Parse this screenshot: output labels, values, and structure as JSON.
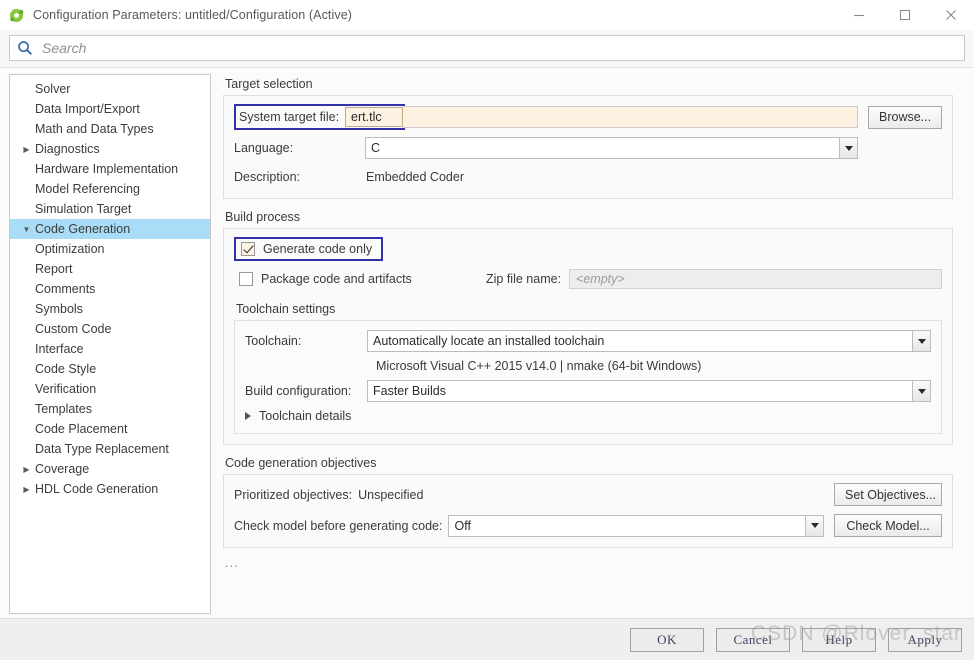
{
  "window": {
    "title": "Configuration Parameters: untitled/Configuration (Active)",
    "app_icon": "simulink-icon",
    "minimize_label": "–",
    "maximize_label": "□",
    "close_label": "×"
  },
  "search": {
    "placeholder": "Search",
    "value": "",
    "icon": "search-icon"
  },
  "sidebar": {
    "items": [
      {
        "label": "Solver",
        "level": 0,
        "arrow": "none",
        "selected": false
      },
      {
        "label": "Data Import/Export",
        "level": 0,
        "arrow": "none",
        "selected": false
      },
      {
        "label": "Math and Data Types",
        "level": 0,
        "arrow": "none",
        "selected": false
      },
      {
        "label": "Diagnostics",
        "level": 0,
        "arrow": "collapsed",
        "selected": false
      },
      {
        "label": "Hardware Implementation",
        "level": 0,
        "arrow": "none",
        "selected": false
      },
      {
        "label": "Model Referencing",
        "level": 0,
        "arrow": "none",
        "selected": false
      },
      {
        "label": "Simulation Target",
        "level": 0,
        "arrow": "none",
        "selected": false
      },
      {
        "label": "Code Generation",
        "level": 0,
        "arrow": "expanded",
        "selected": true
      },
      {
        "label": "Optimization",
        "level": 1,
        "arrow": "none",
        "selected": false
      },
      {
        "label": "Report",
        "level": 1,
        "arrow": "none",
        "selected": false
      },
      {
        "label": "Comments",
        "level": 1,
        "arrow": "none",
        "selected": false
      },
      {
        "label": "Symbols",
        "level": 1,
        "arrow": "none",
        "selected": false
      },
      {
        "label": "Custom Code",
        "level": 1,
        "arrow": "none",
        "selected": false
      },
      {
        "label": "Interface",
        "level": 1,
        "arrow": "none",
        "selected": false
      },
      {
        "label": "Code Style",
        "level": 1,
        "arrow": "none",
        "selected": false
      },
      {
        "label": "Verification",
        "level": 1,
        "arrow": "none",
        "selected": false
      },
      {
        "label": "Templates",
        "level": 1,
        "arrow": "none",
        "selected": false
      },
      {
        "label": "Code Placement",
        "level": 1,
        "arrow": "none",
        "selected": false
      },
      {
        "label": "Data Type Replacement",
        "level": 1,
        "arrow": "none",
        "selected": false
      },
      {
        "label": "Coverage",
        "level": 0,
        "arrow": "collapsed",
        "selected": false
      },
      {
        "label": "HDL Code Generation",
        "level": 0,
        "arrow": "collapsed",
        "selected": false
      }
    ]
  },
  "target_selection": {
    "group_title": "Target selection",
    "system_target_file_label": "System target file:",
    "system_target_file_value": "ert.tlc",
    "browse_label": "Browse...",
    "language_label": "Language:",
    "language_value": "C",
    "description_label": "Description:",
    "description_value": "Embedded Coder"
  },
  "build_process": {
    "group_title": "Build process",
    "generate_code_only_label": "Generate code only",
    "generate_code_only_checked": true,
    "package_code_label": "Package code and artifacts",
    "package_code_checked": false,
    "zip_label": "Zip file name:",
    "zip_placeholder": "<empty>",
    "toolchain_settings_title": "Toolchain settings",
    "toolchain_label": "Toolchain:",
    "toolchain_value": "Automatically locate an installed toolchain",
    "toolchain_note": "Microsoft Visual C++ 2015 v14.0 | nmake (64-bit Windows)",
    "build_configuration_label": "Build configuration:",
    "build_configuration_value": "Faster Builds",
    "toolchain_details_label": "Toolchain details"
  },
  "code_generation_objectives": {
    "group_title": "Code generation objectives",
    "prioritized_label": "Prioritized objectives:",
    "prioritized_value": "Unspecified",
    "set_objectives_label": "Set Objectives...",
    "check_model_label": "Check model before generating code:",
    "check_model_value": "Off",
    "check_model_button_label": "Check Model...",
    "overflow_indicator": "..."
  },
  "footer": {
    "ok_label": "OK",
    "cancel_label": "Cancel",
    "help_label": "Help",
    "apply_label": "Apply"
  },
  "watermark": {
    "text": "CSDN @Rlover_star"
  },
  "colors": {
    "selection_blue": "#a9ddf7",
    "highlight_border": "#3232a8",
    "modified_field": "#fdf1e2",
    "panel_bg": "#fafafa"
  }
}
